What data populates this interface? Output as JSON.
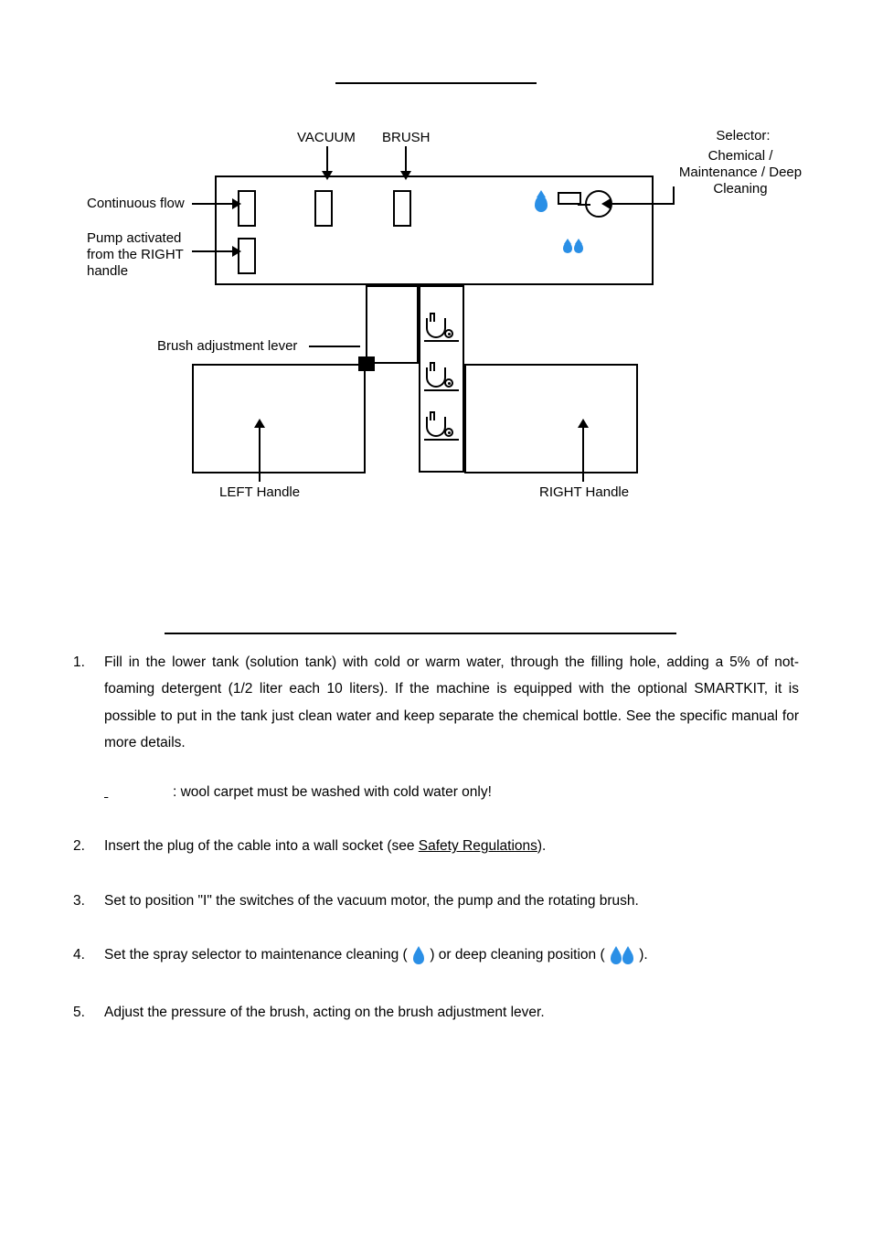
{
  "diagram": {
    "vacuum_label": "VACUUM",
    "brush_label": "BRUSH",
    "selector_title": "Selector:",
    "selector_sub": "Chemical / Maintenance / Deep Cleaning",
    "continuous_flow": "Continuous flow",
    "pump_activated": "Pump activated from the RIGHT handle",
    "brush_lever": "Brush adjustment lever",
    "left_handle": "LEFT Handle",
    "right_handle": "RIGHT Handle"
  },
  "steps": {
    "s1_num": "1.",
    "s1a": "Fill in the lower tank (solution tank) with cold or warm water, through the filling hole, adding a 5% of not-foaming detergent (1/2 liter each 10 liters). If the machine is equipped with the optional SMARTKIT, it is possible to put in the tank just clean water and keep separate the chemical bottle. See the specific manual for more details.",
    "s1_warn_tail": ": wool carpet must be washed with cold water only!",
    "s2_num": "2.",
    "s2a": "Insert the plug of the cable into a wall socket (see ",
    "s2_link": "Safety Regulations",
    "s2b": ").",
    "s3_num": "3.",
    "s3": "Set to position \"I\" the switches of the vacuum motor, the pump and the rotating brush.",
    "s4_num": "4.",
    "s4a": "Set the spray selector to maintenance cleaning ( ",
    "s4b": " ) or deep cleaning position ( ",
    "s4c": " ).",
    "s5_num": "5.",
    "s5": "Adjust the pressure of the brush, acting on the brush adjustment lever."
  }
}
